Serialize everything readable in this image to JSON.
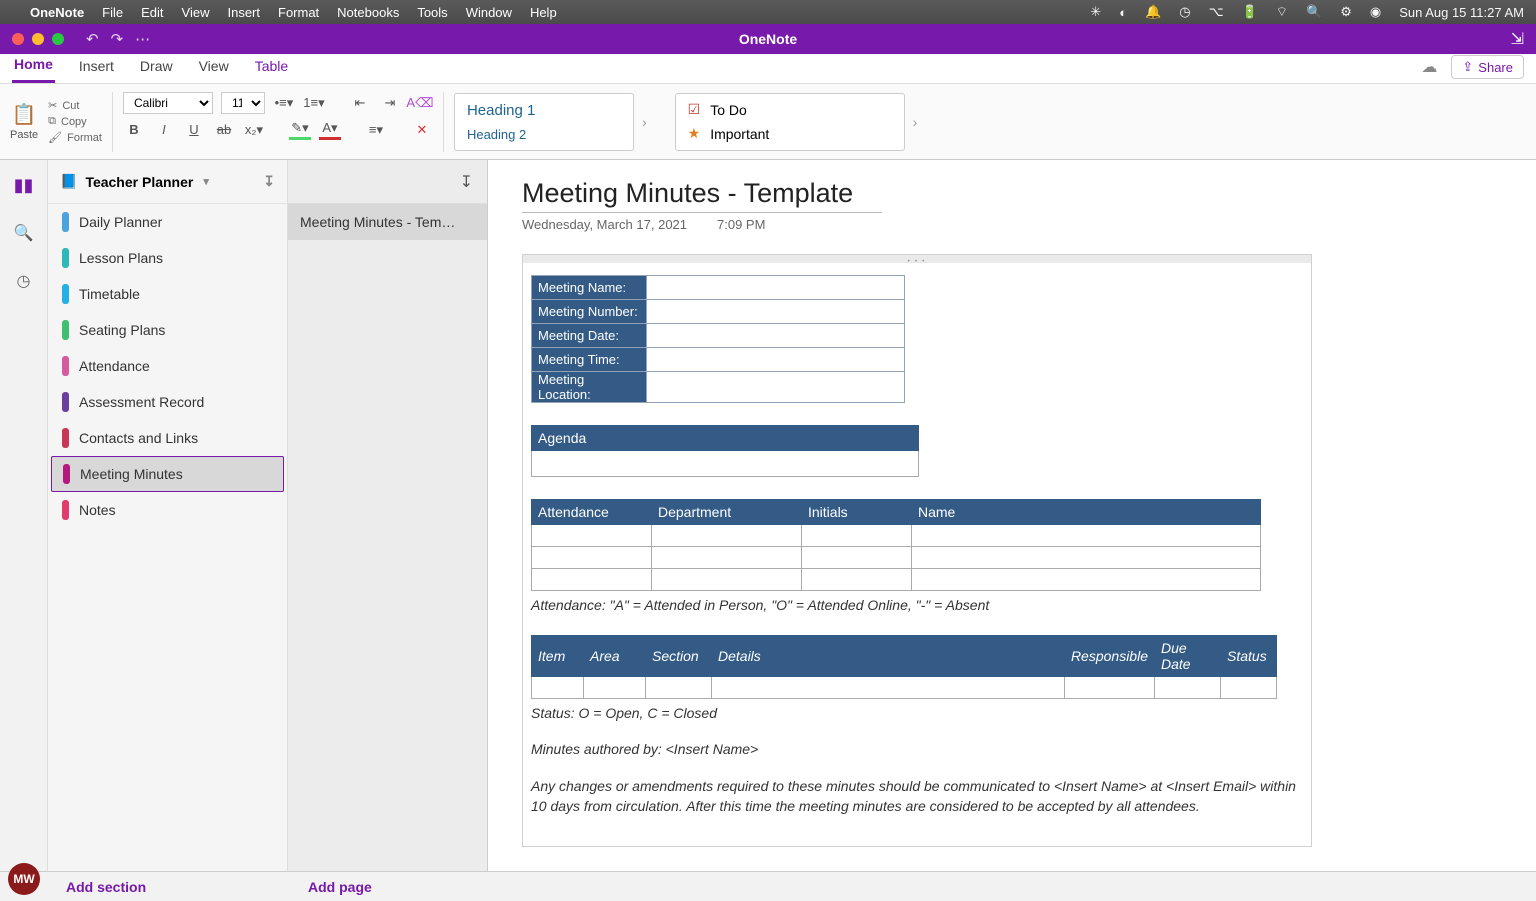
{
  "menubar": {
    "app_name": "OneNote",
    "items": [
      "File",
      "Edit",
      "View",
      "Insert",
      "Format",
      "Notebooks",
      "Tools",
      "Window",
      "Help"
    ],
    "date_time": "Sun Aug 15  11:27 AM"
  },
  "titlebar": {
    "title": "OneNote"
  },
  "tabs": {
    "items": [
      "Home",
      "Insert",
      "Draw",
      "View",
      "Table"
    ],
    "active": "Home",
    "share_label": "Share"
  },
  "ribbon": {
    "paste": "Paste",
    "cut": "Cut",
    "copy": "Copy",
    "format": "Format",
    "font_name": "Calibri",
    "font_size": "11",
    "styles": {
      "h1": "Heading 1",
      "h2": "Heading 2"
    },
    "tags": {
      "todo": "To Do",
      "important": "Important"
    }
  },
  "notebook": {
    "name": "Teacher Planner",
    "sections": [
      {
        "label": "Daily Planner",
        "color": "#4aa3df"
      },
      {
        "label": "Lesson Plans",
        "color": "#2eb8b8"
      },
      {
        "label": "Timetable",
        "color": "#23b0e6"
      },
      {
        "label": "Seating Plans",
        "color": "#3fbf6f"
      },
      {
        "label": "Attendance",
        "color": "#d65a9e"
      },
      {
        "label": "Assessment Record",
        "color": "#6b3fa0"
      },
      {
        "label": "Contacts and Links",
        "color": "#c93756"
      },
      {
        "label": "Meeting Minutes",
        "color": "#b5197e"
      },
      {
        "label": "Notes",
        "color": "#e23b6e"
      }
    ],
    "selected_section": "Meeting Minutes",
    "pages": [
      "Meeting Minutes - Tem…"
    ]
  },
  "page": {
    "title": "Meeting Minutes - Template",
    "date": "Wednesday, March 17, 2021",
    "time": "7:09 PM",
    "meta_fields": [
      "Meeting Name:",
      "Meeting Number:",
      "Meeting Date:",
      "Meeting Time:",
      "Meeting Location:"
    ],
    "agenda_header": "Agenda",
    "attendance_headers": [
      "Attendance",
      "Department",
      "Initials",
      "Name"
    ],
    "attendance_note": "Attendance: \"A\" = Attended in Person, \"O\" = Attended Online, \"-\" = Absent",
    "items_headers": [
      "Item",
      "Area",
      "Section",
      "Details",
      "Responsible",
      "Due Date",
      "Status"
    ],
    "status_note": "Status: O = Open, C = Closed",
    "author_note": "Minutes authored by: <Insert Name>",
    "disclaimer": "Any changes or amendments required to these minutes should be communicated to <Insert Name> at <Insert Email> within 10 days from circulation. After this time the meeting minutes are considered to be accepted by all attendees."
  },
  "footer": {
    "add_section": "Add section",
    "add_page": "Add page",
    "avatar_initials": "MW"
  }
}
